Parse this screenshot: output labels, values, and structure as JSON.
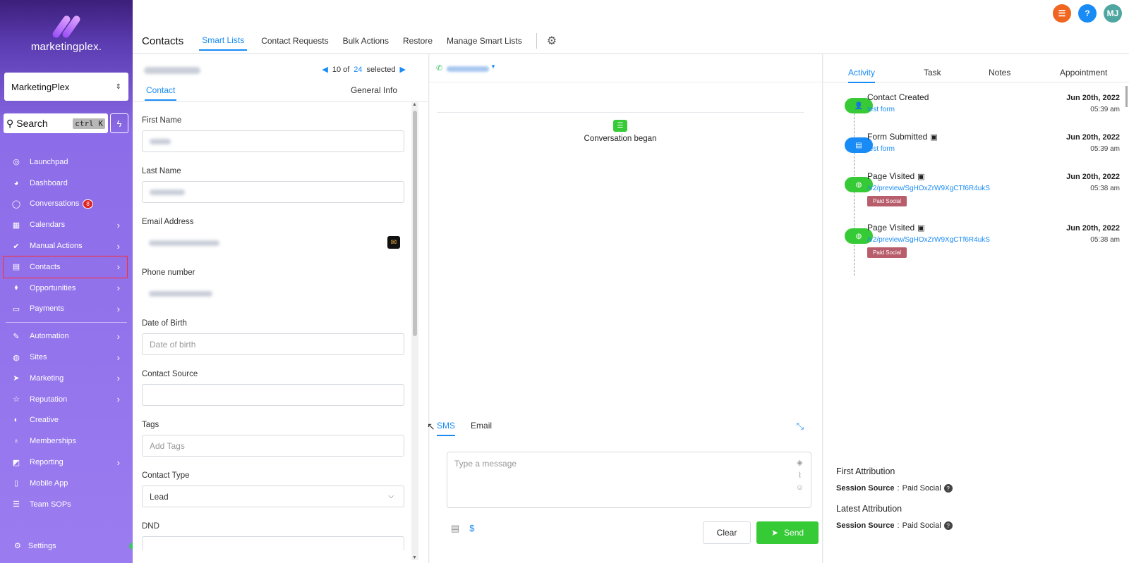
{
  "brand": {
    "name": "marketingplex."
  },
  "account": {
    "name": "MarketingPlex"
  },
  "search": {
    "label": "Search",
    "shortcut": "ctrl K"
  },
  "nav": {
    "items": [
      {
        "label": "Launchpad",
        "icon": "rocket-icon",
        "glyph": "◎",
        "chev": false
      },
      {
        "label": "Dashboard",
        "icon": "dashboard-icon",
        "glyph": "◕",
        "chev": false
      },
      {
        "label": "Conversations",
        "icon": "chat-icon",
        "glyph": "◯",
        "chev": false,
        "badge": "8"
      },
      {
        "label": "Calendars",
        "icon": "calendar-icon",
        "glyph": "▦",
        "chev": true
      },
      {
        "label": "Manual Actions",
        "icon": "check-circle-icon",
        "glyph": "✔",
        "chev": true
      },
      {
        "label": "Contacts",
        "icon": "contacts-icon",
        "glyph": "▤",
        "chev": true,
        "active": true
      },
      {
        "label": "Opportunities",
        "icon": "funnel-icon",
        "glyph": "⬧",
        "chev": true
      },
      {
        "label": "Payments",
        "icon": "payments-icon",
        "glyph": "▭",
        "chev": true
      }
    ],
    "items2": [
      {
        "label": "Automation",
        "icon": "automation-icon",
        "glyph": "✎",
        "chev": true
      },
      {
        "label": "Sites",
        "icon": "globe-icon",
        "glyph": "◍",
        "chev": true
      },
      {
        "label": "Marketing",
        "icon": "send-icon",
        "glyph": "➤",
        "chev": true
      },
      {
        "label": "Reputation",
        "icon": "star-icon",
        "glyph": "☆",
        "chev": true
      },
      {
        "label": "Creative",
        "icon": "palette-icon",
        "glyph": "◐",
        "chev": false
      },
      {
        "label": "Memberships",
        "icon": "badge-icon",
        "glyph": "♁",
        "chev": false
      },
      {
        "label": "Reporting",
        "icon": "chart-icon",
        "glyph": "◩",
        "chev": true
      },
      {
        "label": "Mobile App",
        "icon": "mobile-icon",
        "glyph": "▯",
        "chev": false
      },
      {
        "label": "Team SOPs",
        "icon": "list-icon",
        "glyph": "☰",
        "chev": false
      }
    ],
    "settings": "Settings"
  },
  "top": {
    "avatar": "MJ",
    "icon_colors": {
      "tasks": "#f0651f",
      "help": "#188bf6",
      "avatar": "#4fa6a0"
    }
  },
  "tabs": {
    "title": "Contacts",
    "items": [
      "Smart Lists",
      "Contact Requests",
      "Bulk Actions",
      "Restore",
      "Manage Smart Lists"
    ]
  },
  "contact": {
    "pager": {
      "current": "10 of",
      "total": "24",
      "suffix": "selected"
    },
    "tabs": {
      "contact": "Contact",
      "general": "General Info"
    },
    "fields": {
      "first_name": "First Name",
      "last_name": "Last Name",
      "email": "Email Address",
      "phone": "Phone number",
      "dob": "Date of Birth",
      "dob_placeholder": "Date of birth",
      "source": "Contact Source",
      "tags": "Tags",
      "tags_placeholder": "Add Tags",
      "type": "Contact Type",
      "type_value": "Lead",
      "dnd": "DND"
    }
  },
  "conversation": {
    "began": "Conversation began",
    "tabs": [
      "SMS",
      "Email"
    ],
    "placeholder": "Type a message",
    "clear": "Clear",
    "send": "Send"
  },
  "activity": {
    "tabs": [
      "Activity",
      "Task",
      "Notes",
      "Appointment"
    ],
    "items": [
      {
        "title": "Contact Created",
        "sub": "test form",
        "date": "Jun 20th, 2022",
        "time": "05:39 am",
        "color": "#37ca37",
        "icon": "user-plus-icon",
        "glyph": "👤",
        "clip": false
      },
      {
        "title": "Form Submitted",
        "sub": "test form",
        "date": "Jun 20th, 2022",
        "time": "05:39 am",
        "color": "#188bf6",
        "icon": "form-icon",
        "glyph": "▤",
        "clip": true
      },
      {
        "title": "Page Visited",
        "sub": "/v2/preview/SgHOxZrW9XgCTf6R4ukS",
        "date": "Jun 20th, 2022",
        "time": "05:38 am",
        "color": "#37ca37",
        "icon": "globe-icon",
        "glyph": "◍",
        "clip": true,
        "tag": "Paid Social"
      },
      {
        "title": "Page Visited",
        "sub": "/v2/preview/SgHOxZrW9XgCTf6R4ukS",
        "date": "Jun 20th, 2022",
        "time": "05:38 am",
        "color": "#37ca37",
        "icon": "globe-icon",
        "glyph": "◍",
        "clip": true,
        "tag": "Paid Social"
      }
    ],
    "first_attr": {
      "heading": "First Attribution",
      "label": "Session Source",
      "value": "Paid Social"
    },
    "latest_attr": {
      "heading": "Latest Attribution",
      "label": "Session Source",
      "value": "Paid Social"
    }
  }
}
